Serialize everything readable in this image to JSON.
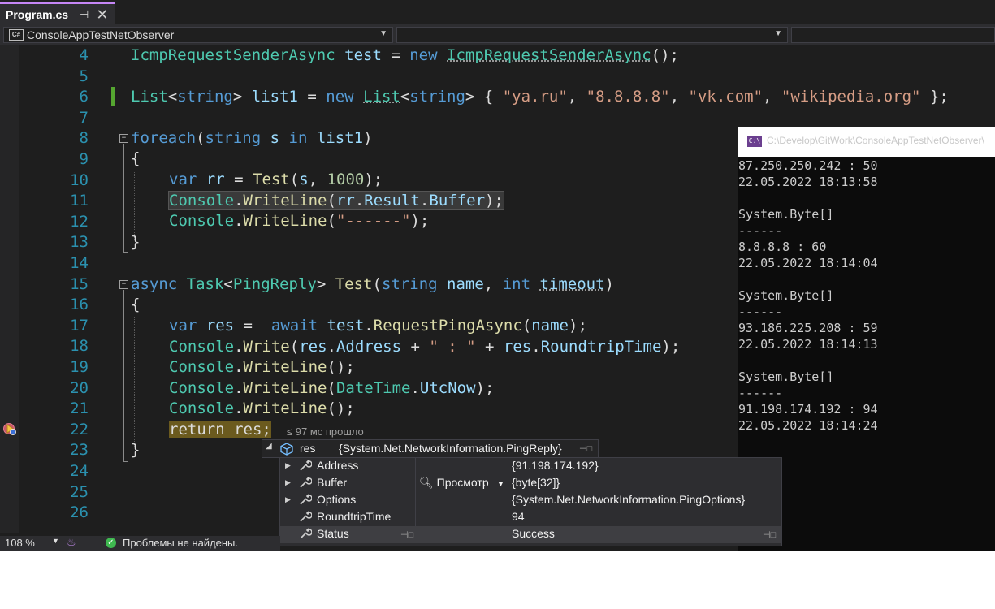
{
  "tab": {
    "title": "Program.cs",
    "pin": "⊣",
    "close": "✕"
  },
  "nav": {
    "project": "ConsoleAppTestNetObserver",
    "member": "",
    "scope": "",
    "cs_icon": "C#"
  },
  "lines": [
    {
      "n": "4"
    },
    {
      "n": "5"
    },
    {
      "n": "6"
    },
    {
      "n": "7"
    },
    {
      "n": "8"
    },
    {
      "n": "9"
    },
    {
      "n": "10"
    },
    {
      "n": "11"
    },
    {
      "n": "12"
    },
    {
      "n": "13"
    },
    {
      "n": "14"
    },
    {
      "n": "15"
    },
    {
      "n": "16"
    },
    {
      "n": "17"
    },
    {
      "n": "18"
    },
    {
      "n": "19"
    },
    {
      "n": "20"
    },
    {
      "n": "21"
    },
    {
      "n": "22"
    },
    {
      "n": "23"
    },
    {
      "n": "24"
    },
    {
      "n": "25"
    },
    {
      "n": "26"
    }
  ],
  "code": {
    "l4": [
      "IcmpRequestSenderAsync",
      " ",
      "test",
      " = ",
      "new",
      " ",
      "IcmpRequestSenderAsync",
      "();"
    ],
    "l6": [
      "List",
      "<",
      "string",
      "> ",
      "list1",
      " = ",
      "new",
      " ",
      "List",
      "<",
      "string",
      "> { ",
      "\"ya.ru\"",
      ", ",
      "\"8.8.8.8\"",
      ", ",
      "\"vk.com\"",
      ", ",
      "\"wikipedia.org\"",
      " };"
    ],
    "l8": [
      "foreach",
      "(",
      "string",
      " ",
      "s",
      " ",
      "in",
      " ",
      "list1",
      ")"
    ],
    "l9": "{",
    "l10": [
      "var",
      " ",
      "rr",
      " = ",
      "Test",
      "(",
      "s",
      ", ",
      "1000",
      ");"
    ],
    "l11": [
      "Console",
      ".",
      "WriteLine",
      "(",
      "rr",
      ".",
      "Result",
      ".",
      "Buffer",
      ");"
    ],
    "l12": [
      "Console",
      ".",
      "WriteLine",
      "(",
      "\"------\"",
      ");"
    ],
    "l13": "}",
    "l15": [
      "async",
      " ",
      "Task",
      "<",
      "PingReply",
      "> ",
      "Test",
      "(",
      "string",
      " ",
      "name",
      ", ",
      "int",
      " ",
      "timeout",
      ")"
    ],
    "l16": "{",
    "l17": [
      "var",
      " ",
      "res",
      " =  ",
      "await",
      " ",
      "test",
      ".",
      "RequestPingAsync",
      "(",
      "name",
      ");"
    ],
    "l18": [
      "Console",
      ".",
      "Write",
      "(",
      "res",
      ".",
      "Address",
      " + ",
      "\" : \"",
      " + ",
      "res",
      ".",
      "RoundtripTime",
      ");"
    ],
    "l19": [
      "Console",
      ".",
      "WriteLine",
      "();"
    ],
    "l20": [
      "Console",
      ".",
      "WriteLine",
      "(",
      "DateTime",
      ".",
      "UtcNow",
      ");"
    ],
    "l21": [
      "Console",
      ".",
      "WriteLine",
      "();"
    ],
    "l22": [
      "return",
      " ",
      "res",
      ";"
    ],
    "l23": "}"
  },
  "perf_tip": "≤ 97 мс прошло",
  "console": {
    "icon": "C:\\",
    "title": "C:\\Develop\\GitWork\\ConsoleAppTestNetObserver\\",
    "lines": [
      "87.250.250.242 : 50",
      "22.05.2022 18:13:58",
      "",
      "System.Byte[]",
      "------",
      "8.8.8.8 : 60",
      "22.05.2022 18:14:04",
      "",
      "System.Byte[]",
      "------",
      "93.186.225.208 : 59",
      "22.05.2022 18:14:13",
      "",
      "System.Byte[]",
      "------",
      "91.198.174.192 : 94",
      "22.05.2022 18:14:24"
    ]
  },
  "datatip": {
    "name": "res",
    "value": "{System.Net.NetworkInformation.PingReply}",
    "viewer_label": "Просмотр",
    "rows": [
      {
        "name": "Address",
        "value": "{91.198.174.192}",
        "expandable": true
      },
      {
        "name": "Buffer",
        "value": "{byte[32]}",
        "expandable": true
      },
      {
        "name": "Options",
        "value": "{System.Net.NetworkInformation.PingOptions}",
        "expandable": true
      },
      {
        "name": "RoundtripTime",
        "value": "94",
        "expandable": false
      },
      {
        "name": "Status",
        "value": "Success",
        "expandable": false
      }
    ]
  },
  "status": {
    "zoom": "108 %",
    "issues": "Проблемы не найдены."
  }
}
